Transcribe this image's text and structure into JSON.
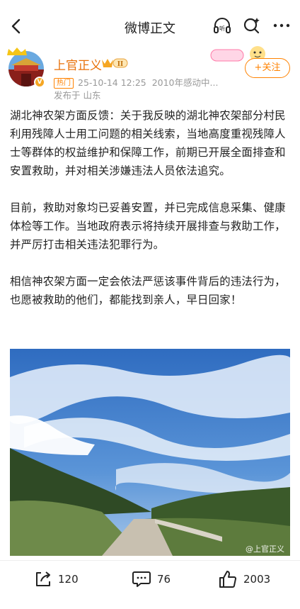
{
  "header": {
    "title": "微博正文"
  },
  "author": {
    "name": "上官正义",
    "level_badge": "II",
    "hot_tag": "热门",
    "timestamp": "25-10-14 12:25",
    "source": "2010年感动中...",
    "location": "发布于 山东",
    "follow_label": "+关注"
  },
  "post": {
    "paragraphs": [
      "湖北神农架方面反馈：关于我反映的湖北神农架部分村民利用残障人士用工问题的相关线索，当地高度重视残障人士等群体的权益维护和保障工作，前期已开展全面排查和安置救助，并对相关涉嫌违法人员依法追究。",
      "目前，救助对象均已妥善安置，并已完成信息采集、健康体检等工作。当地政府表示将持续开展排查与救助工作，并严厉打击相关违法犯罪行为。",
      "相信神农架方面一定会依法严惩该事件背后的违法行为，也愿被救助的他们，都能找到亲人，早日回家！"
    ],
    "image_watermark": "@上官正义"
  },
  "actions": {
    "repost_count": "120",
    "comment_count": "76",
    "like_count": "2003"
  },
  "colors": {
    "accent": "#ff8200",
    "name": "#e8710a"
  }
}
